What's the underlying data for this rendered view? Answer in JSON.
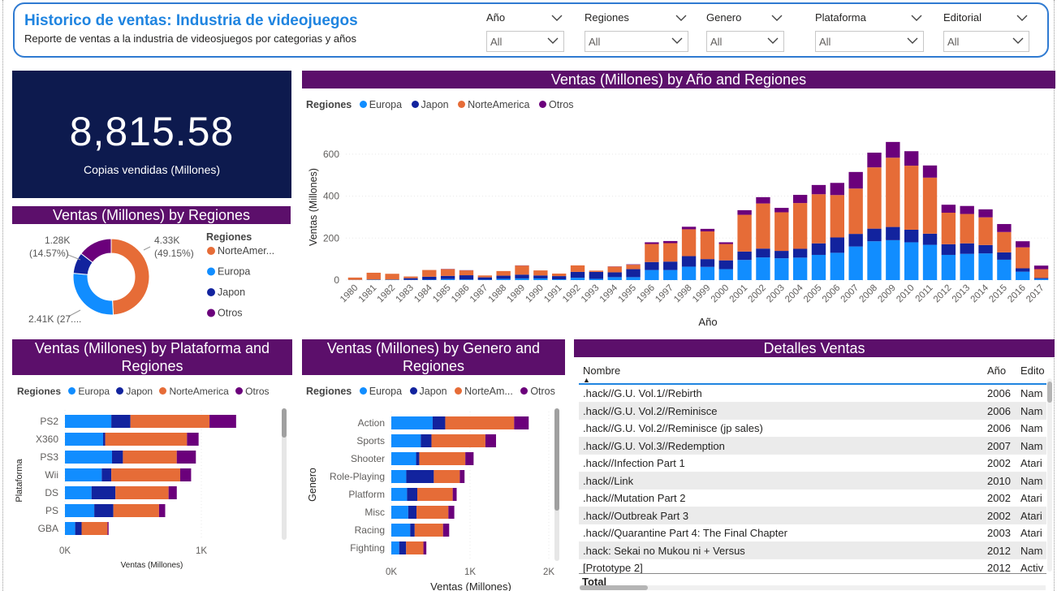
{
  "header": {
    "title": "Historico de ventas: Industria de videojuegos",
    "subtitle": "Reporte de ventas a la industria de videosjuegos por categorias y años"
  },
  "filters": [
    {
      "label": "Año",
      "value": "All"
    },
    {
      "label": "Regiones",
      "value": "All"
    },
    {
      "label": "Genero",
      "value": "All"
    },
    {
      "label": "Plataforma",
      "value": "All"
    },
    {
      "label": "Editorial",
      "value": "All"
    }
  ],
  "kpi": {
    "value": "8,815.58",
    "label": "Copias vendidas (Millones)"
  },
  "colors": {
    "Europa": "#118dff",
    "Japon": "#12239e",
    "NorteAmerica": "#e66c37",
    "Otros": "#6b007b",
    "title_bg": "#5c0f6b"
  },
  "donut": {
    "title": "Ventas (Millones) by Regiones",
    "legend_title": "Regiones",
    "legend": [
      "NorteAmer...",
      "Europa",
      "Japon",
      "Otros"
    ],
    "labels": {
      "na_value": "4.33K",
      "na_pct": "(49.15%)",
      "otros_value": "1.28K",
      "otros_pct": "(14.57%)",
      "europa_text": "2.41K (27...."
    }
  },
  "year_chart": {
    "title": "Ventas (Millones) by Año and Regiones",
    "legend_title": "Regiones",
    "legend": [
      "Europa",
      "Japon",
      "NorteAmerica",
      "Otros"
    ],
    "ylabel": "Ventas (Millones)",
    "xlabel": "Año",
    "yticks": [
      "0",
      "200",
      "400",
      "600"
    ]
  },
  "platform_chart": {
    "title": "Ventas (Millones) by Plataforma and Regiones",
    "legend_title": "Regiones",
    "legend": [
      "Europa",
      "Japon",
      "NorteAmerica",
      "Otros"
    ],
    "ylabel": "Plataforma",
    "xlabel": "Ventas (Millones)",
    "xticks": [
      "0K",
      "1K"
    ]
  },
  "genre_chart": {
    "title": "Ventas (Millones) by Genero and Regiones",
    "legend_title": "Regiones",
    "legend": [
      "Europa",
      "Japon",
      "NorteAm...",
      "Otros"
    ],
    "ylabel": "Genero",
    "xlabel": "Ventas (Millones)",
    "xticks": [
      "0K",
      "1K",
      "2K"
    ]
  },
  "table": {
    "title": "Detalles Ventas",
    "columns": [
      "Nombre",
      "Año",
      "Edito"
    ],
    "rows": [
      [
        ".hack//G.U. Vol.1//Rebirth",
        "2006",
        "Nam"
      ],
      [
        ".hack//G.U. Vol.2//Reminisce",
        "2006",
        "Nam"
      ],
      [
        ".hack//G.U. Vol.2//Reminisce (jp sales)",
        "2006",
        "Nam"
      ],
      [
        ".hack//G.U. Vol.3//Redemption",
        "2007",
        "Nam"
      ],
      [
        ".hack//Infection Part 1",
        "2002",
        "Atari"
      ],
      [
        ".hack//Link",
        "2010",
        "Nam"
      ],
      [
        ".hack//Mutation Part 2",
        "2002",
        "Atari"
      ],
      [
        ".hack//Outbreak Part 3",
        "2002",
        "Atari"
      ],
      [
        ".hack//Quarantine Part 4: The Final Chapter",
        "2003",
        "Atari"
      ],
      [
        ".hack: Sekai no Mukou ni + Versus",
        "2012",
        "Nam"
      ],
      [
        "[Prototype 2]",
        "2012",
        "Activ"
      ]
    ],
    "total_label": "Total"
  },
  "chart_data": [
    {
      "type": "pie",
      "title": "Ventas (Millones) by Regiones",
      "categories": [
        "NorteAmerica",
        "Europa",
        "Japon",
        "Otros"
      ],
      "values": [
        4330,
        2410,
        790,
        1280
      ],
      "percent": [
        49.15,
        27.3,
        8.98,
        14.57
      ]
    },
    {
      "type": "bar",
      "title": "Ventas (Millones) by Año and Regiones",
      "xlabel": "Año",
      "ylabel": "Ventas (Millones)",
      "ylim": [
        0,
        700
      ],
      "categories": [
        "1980",
        "1981",
        "1982",
        "1983",
        "1984",
        "1985",
        "1986",
        "1987",
        "1988",
        "1989",
        "1990",
        "1991",
        "1992",
        "1993",
        "1994",
        "1995",
        "1996",
        "1997",
        "1998",
        "1999",
        "2000",
        "2001",
        "2002",
        "2003",
        "2004",
        "2005",
        "2006",
        "2007",
        "2008",
        "2009",
        "2010",
        "2011",
        "2012",
        "2013",
        "2014",
        "2015",
        "2016",
        "2017"
      ],
      "series": [
        {
          "name": "Europa",
          "values": [
            1,
            2,
            2,
            1,
            2,
            5,
            3,
            2,
            6,
            8,
            8,
            4,
            11,
            6,
            14,
            14,
            48,
            48,
            64,
            63,
            52,
            96,
            108,
            104,
            107,
            120,
            130,
            160,
            185,
            190,
            180,
            168,
            120,
            125,
            127,
            97,
            40,
            6
          ]
        },
        {
          "name": "Japon",
          "values": [
            0,
            0,
            0,
            8,
            14,
            15,
            20,
            11,
            15,
            18,
            14,
            15,
            28,
            33,
            23,
            38,
            38,
            40,
            50,
            37,
            42,
            40,
            42,
            35,
            42,
            55,
            73,
            60,
            60,
            63,
            60,
            53,
            51,
            50,
            40,
            35,
            16,
            4
          ]
        },
        {
          "name": "NorteAmerica",
          "values": [
            11,
            33,
            28,
            8,
            32,
            32,
            23,
            9,
            22,
            43,
            24,
            12,
            31,
            6,
            27,
            21,
            86,
            88,
            128,
            132,
            78,
            175,
            215,
            184,
            218,
            234,
            202,
            216,
            292,
            330,
            305,
            267,
            150,
            140,
            132,
            97,
            100,
            42
          ]
        },
        {
          "name": "Otros",
          "values": [
            0,
            0,
            0,
            0,
            0,
            1,
            1,
            0,
            0,
            1,
            0,
            0,
            0,
            0,
            1,
            2,
            8,
            10,
            12,
            12,
            8,
            22,
            30,
            21,
            39,
            44,
            58,
            79,
            70,
            75,
            69,
            58,
            38,
            38,
            38,
            38,
            29,
            17
          ]
        }
      ]
    },
    {
      "type": "bar",
      "title": "Ventas (Millones) by Plataforma and Regiones",
      "orientation": "horizontal",
      "xlabel": "Ventas (Millones)",
      "ylabel": "Plataforma",
      "xlim": [
        0,
        1250
      ],
      "categories": [
        "PS2",
        "X360",
        "PS3",
        "Wii",
        "DS",
        "PS",
        "GBA"
      ],
      "series": [
        {
          "name": "Europa",
          "values": [
            340,
            280,
            345,
            270,
            195,
            215,
            75
          ]
        },
        {
          "name": "Japon",
          "values": [
            140,
            15,
            80,
            70,
            175,
            140,
            47
          ]
        },
        {
          "name": "NorteAmerica",
          "values": [
            580,
            600,
            395,
            505,
            390,
            335,
            190
          ]
        },
        {
          "name": "Otros",
          "values": [
            195,
            85,
            140,
            80,
            60,
            45,
            8
          ]
        }
      ]
    },
    {
      "type": "bar",
      "title": "Ventas (Millones) by Genero and Regiones",
      "orientation": "horizontal",
      "xlabel": "Ventas (Millones)",
      "ylabel": "Genero",
      "xlim": [
        0,
        2000
      ],
      "categories": [
        "Action",
        "Sports",
        "Shooter",
        "Role-Playing",
        "Platform",
        "Misc",
        "Racing",
        "Fighting"
      ],
      "series": [
        {
          "name": "Europa",
          "values": [
            525,
            375,
            315,
            190,
            200,
            215,
            240,
            100
          ]
        },
        {
          "name": "Japon",
          "values": [
            160,
            135,
            40,
            350,
            130,
            105,
            57,
            88
          ]
        },
        {
          "name": "NorteAmerica",
          "values": [
            875,
            685,
            585,
            330,
            450,
            405,
            360,
            220
          ]
        },
        {
          "name": "Otros",
          "values": [
            185,
            135,
            105,
            60,
            50,
            75,
            78,
            37
          ]
        }
      ]
    }
  ]
}
